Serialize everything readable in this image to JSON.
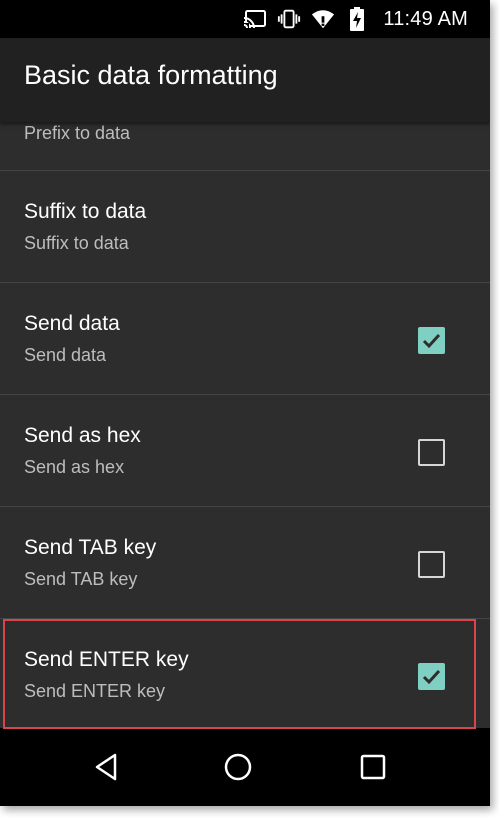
{
  "status_bar": {
    "time": "11:49 AM",
    "icons": [
      "cast-icon",
      "vibrate-icon",
      "wifi-icon",
      "battery-charging-icon"
    ]
  },
  "header": {
    "title": "Basic data formatting"
  },
  "settings": {
    "partial_item": {
      "summary": "Prefix to data"
    },
    "items": [
      {
        "title": "Suffix to data",
        "summary": "Suffix to data",
        "has_checkbox": false
      },
      {
        "title": "Send data",
        "summary": "Send data",
        "has_checkbox": true,
        "checked": true
      },
      {
        "title": "Send as hex",
        "summary": "Send as hex",
        "has_checkbox": true,
        "checked": false
      },
      {
        "title": "Send TAB key",
        "summary": "Send TAB key",
        "has_checkbox": true,
        "checked": false
      },
      {
        "title": "Send ENTER key",
        "summary": "Send ENTER key",
        "has_checkbox": true,
        "checked": true,
        "highlighted": true
      }
    ]
  },
  "nav_bar": {
    "buttons": [
      "back-icon",
      "home-icon",
      "recents-icon"
    ]
  },
  "colors": {
    "checkbox_checked": "#7fcfc2",
    "highlight": "#d9454b",
    "background": "#2d2d2d",
    "action_bar": "#212121"
  }
}
